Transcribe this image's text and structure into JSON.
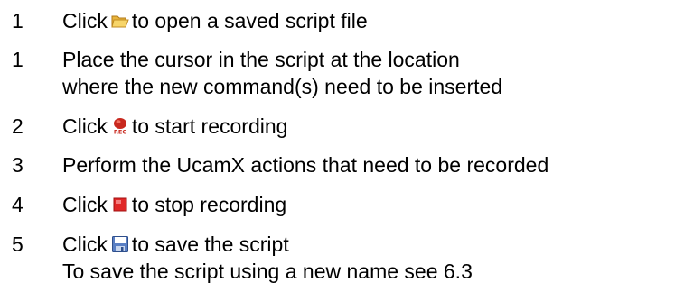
{
  "steps": [
    {
      "number": "1",
      "before": "Click",
      "icon": "open-folder-icon",
      "after": "to open a saved script file"
    },
    {
      "number": "1",
      "line1": "Place the cursor in the script at the location",
      "line2": "where the new command(s) need to be inserted"
    },
    {
      "number": "2",
      "before": "Click",
      "icon": "record-icon",
      "after": "to start recording"
    },
    {
      "number": "3",
      "text": "Perform the UcamX actions that need to be recorded"
    },
    {
      "number": "4",
      "before": "Click",
      "icon": "stop-icon",
      "after": "to stop recording"
    },
    {
      "number": "5",
      "before": "Click",
      "icon": "save-icon",
      "after": "to save the script",
      "line2": "To save the script using a new name see 6.3"
    }
  ]
}
